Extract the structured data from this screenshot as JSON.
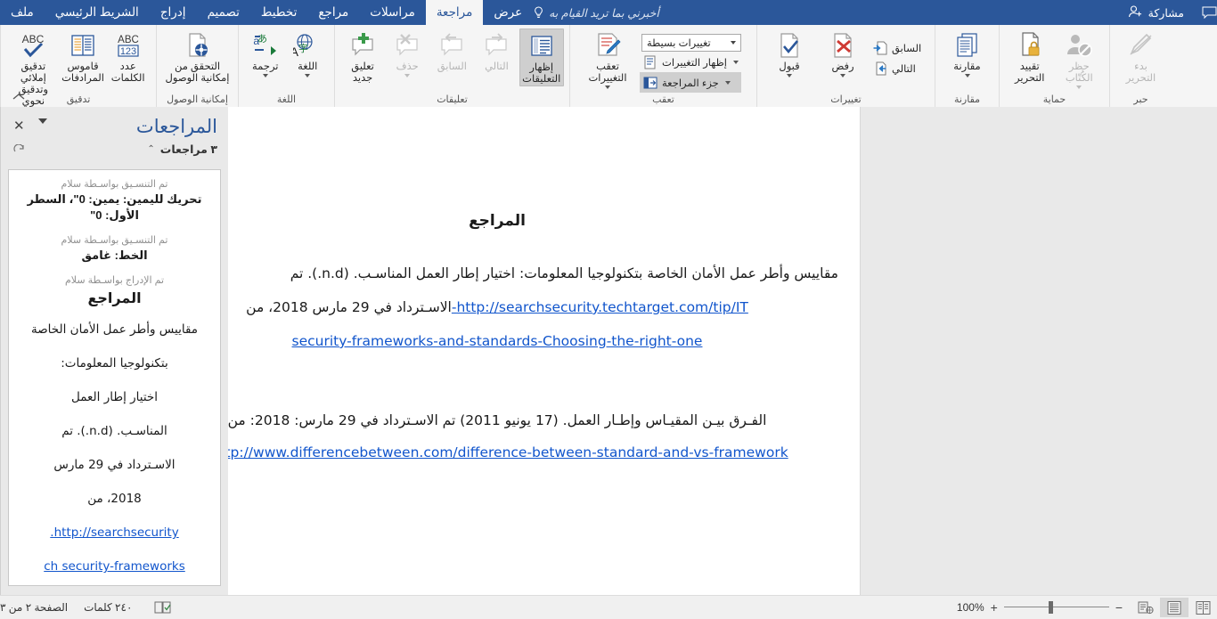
{
  "titlebar": {
    "tabs": [
      {
        "id": "file",
        "label": "ملف",
        "active": false
      },
      {
        "id": "home",
        "label": "الشريط الرئيسي",
        "active": false
      },
      {
        "id": "insert",
        "label": "إدراج",
        "active": false
      },
      {
        "id": "design",
        "label": "تصميم",
        "active": false
      },
      {
        "id": "layout",
        "label": "تخطيط",
        "active": false
      },
      {
        "id": "refs",
        "label": "مراجع",
        "active": false
      },
      {
        "id": "mailings",
        "label": "مراسلات",
        "active": false
      },
      {
        "id": "review",
        "label": "مراجعة",
        "active": true
      },
      {
        "id": "view",
        "label": "عرض",
        "active": false
      }
    ],
    "tellme_placeholder": "أخبرني بما تريد القيام به",
    "share_label": "مشاركة",
    "bulb_icon": "lightbulb-icon",
    "share_icon": "share-person-icon",
    "comments_icon": "comment-balloon-icon"
  },
  "ribbon": {
    "collapse_icon": "chevron-up-icon",
    "groups": [
      {
        "id": "proofing",
        "title": "تدقيق",
        "buttons": [
          {
            "id": "spelling",
            "label": "تدقيق إملائي\nوتدقيق نحوي",
            "icon": "abc-check-icon",
            "disabled": false,
            "dropdown": false
          },
          {
            "id": "thesaurus",
            "label": "قاموس\nالمرادفات",
            "icon": "book-icon",
            "disabled": false,
            "dropdown": false
          },
          {
            "id": "wordcount",
            "label": "عدد\nالكلمات",
            "icon": "abc-123-icon",
            "disabled": false,
            "dropdown": false
          }
        ]
      },
      {
        "id": "accessibility",
        "title": "إمكانية الوصول",
        "buttons": [
          {
            "id": "check-accessibility",
            "label": "التحقق من\nإمكانية الوصول",
            "icon": "accessibility-check-icon",
            "disabled": false,
            "dropdown": false
          }
        ]
      },
      {
        "id": "language",
        "title": "اللغة",
        "buttons": [
          {
            "id": "translate",
            "label": "ترجمة",
            "icon": "translate-icon",
            "disabled": false,
            "dropdown": true
          },
          {
            "id": "language",
            "label": "اللغة",
            "icon": "globe-text-icon",
            "disabled": false,
            "dropdown": true
          }
        ]
      },
      {
        "id": "comments",
        "title": "تعليقات",
        "buttons": [
          {
            "id": "new-comment",
            "label": "تعليق\nجديد",
            "icon": "comment-plus-icon",
            "disabled": false,
            "dropdown": false
          },
          {
            "id": "delete-comment",
            "label": "حذف",
            "icon": "comment-delete-icon",
            "disabled": true,
            "dropdown": true
          },
          {
            "id": "prev-comment",
            "label": "السابق",
            "icon": "comment-prev-icon",
            "disabled": true,
            "dropdown": false
          },
          {
            "id": "next-comment",
            "label": "التالي",
            "icon": "comment-next-icon",
            "disabled": true,
            "dropdown": false
          },
          {
            "id": "show-comments",
            "label": "إظهار\nالتعليقات",
            "icon": "show-comments-icon",
            "disabled": false,
            "dropdown": false,
            "selected": true
          }
        ]
      },
      {
        "id": "tracking",
        "title": "تعقب",
        "dialog_launcher": "dialog-launcher-icon",
        "buttons": [
          {
            "id": "track-changes",
            "label": "تعقب\nالتغييرات",
            "icon": "track-changes-icon",
            "disabled": false,
            "dropdown": true
          }
        ],
        "display_select": {
          "id": "display-for-review",
          "value": "تغييرات بسيطة",
          "icon": "display-review-icon"
        },
        "small_buttons": [
          {
            "id": "show-markup",
            "label": "إظهار التغييرات",
            "icon": "show-markup-icon",
            "dropdown": true,
            "selected": false
          },
          {
            "id": "reviewing-pane",
            "label": "جزء المراجعة",
            "icon": "reviewing-pane-icon",
            "dropdown": true,
            "selected": true
          }
        ]
      },
      {
        "id": "changes",
        "title": "تغييرات",
        "buttons": [
          {
            "id": "accept",
            "label": "قبول",
            "icon": "accept-check-icon",
            "disabled": false,
            "dropdown": true
          },
          {
            "id": "reject",
            "label": "رفض",
            "icon": "reject-x-icon",
            "disabled": false,
            "dropdown": true
          }
        ],
        "small_buttons": [
          {
            "id": "previous-change",
            "label": "السابق",
            "icon": "prev-change-icon",
            "dropdown": false
          },
          {
            "id": "next-change",
            "label": "التالي",
            "icon": "next-change-icon",
            "dropdown": false
          }
        ]
      },
      {
        "id": "compare",
        "title": "مقارنة",
        "buttons": [
          {
            "id": "compare",
            "label": "مقارنة",
            "icon": "compare-docs-icon",
            "disabled": false,
            "dropdown": true
          }
        ]
      },
      {
        "id": "protect",
        "title": "حماية",
        "buttons": [
          {
            "id": "restrict-editing",
            "label": "تقييد\nالتحرير",
            "icon": "lock-doc-icon",
            "disabled": false,
            "dropdown": false
          },
          {
            "id": "block-authors",
            "label": "حظر\nالكُتّاب",
            "icon": "block-author-icon",
            "disabled": true,
            "dropdown": true
          }
        ]
      },
      {
        "id": "ink",
        "title": "حبر",
        "buttons": [
          {
            "id": "start-inking",
            "label": "بدء\nالتحرير",
            "icon": "pen-icon",
            "disabled": true,
            "dropdown": false
          }
        ]
      }
    ]
  },
  "document": {
    "title": "المراجع",
    "change_bar_color": "#ff0000",
    "paragraphs": [
      {
        "id": "ref-1",
        "line1": "مقاييس وأطر عمل الأمان الخاصة بتكنولوجيا المعلومات: اختيار إطار العمل المناسـب. (n.d.). تم",
        "line2_before": "الاسـترداد في 29 مارس 2018، من",
        "link1": "http://searchsecurity.techtarget.com/tip/IT-",
        "link2": "security-frameworks-and-standards-Choosing-the-right-one"
      },
      {
        "id": "ref-2",
        "line1": "الفـرق بيـن المقيـاس وإطـار العمل. (17 يونيو 2011) تم الاسـترداد في 29 مارس: 2018: من",
        "link1": "http://www.differencebetween.com/difference-between-standard-and-vs-framework/"
      }
    ]
  },
  "reviewing_pane": {
    "title": "المراجعات",
    "count_label": "٣ مراجعات",
    "collapse_icon": "chevron-up-icon",
    "refresh_icon": "refresh-icon",
    "close_icon": "close-icon",
    "menu_icon": "chevron-down-icon",
    "revisions": [
      {
        "id": "rev-1",
        "meta": "تم التنسـيق بواسـطة سلام",
        "value": "تحريك لليمين: يمين: 0\"، السطر الأول: 0\""
      },
      {
        "id": "rev-2",
        "meta": "تم التنسـيق بواسـطة سلام",
        "value": "الخط: غامق"
      },
      {
        "id": "rev-3",
        "meta": "تم الإدراج بواسـطة سلام",
        "heading": "المراجع",
        "lines": [
          "مقاييس وأطر عمل الأمان الخاصة",
          "بتكنولوجيا المعلومات:",
          "اختيار إطار العمل",
          "المناسـب. (n.d.). تم",
          "الاسـترداد في 29 مارس",
          "2018، من"
        ],
        "link_lines": [
          "http://searchsecurity.",
          "ch security-frameworks"
        ]
      }
    ]
  },
  "statusbar": {
    "page_label": "الصفحة ٢ من ٣",
    "words_label": "٢٤٠ كلمات",
    "proofing_icon": "proofing-status-icon",
    "views": [
      {
        "id": "read-mode",
        "icon": "read-mode-icon",
        "active": false
      },
      {
        "id": "print-layout",
        "icon": "print-layout-icon",
        "active": true
      },
      {
        "id": "web-layout",
        "icon": "web-layout-icon",
        "active": false
      }
    ],
    "zoom_percent": "100%",
    "zoom_out_icon": "minus-icon",
    "zoom_in_icon": "plus-icon"
  }
}
